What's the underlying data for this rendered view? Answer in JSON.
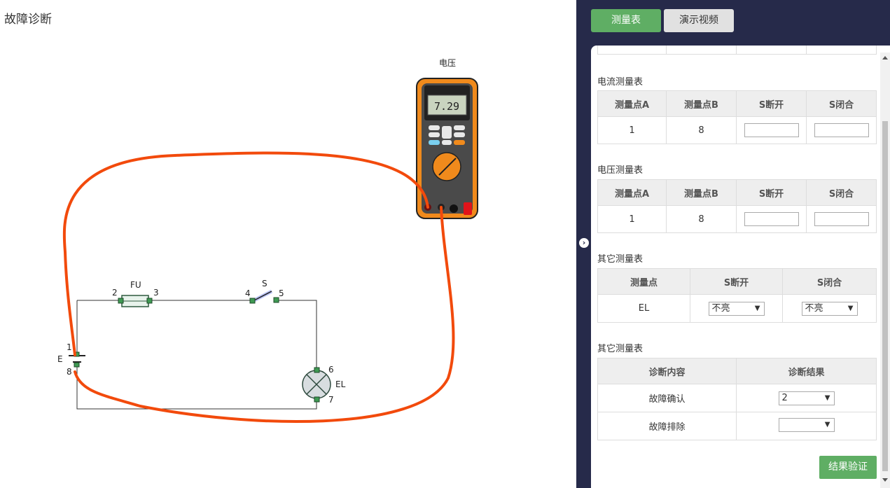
{
  "page_title": "故障诊断",
  "meter": {
    "label": "电压",
    "reading": "7.29"
  },
  "circuit": {
    "labels": {
      "fu": "FU",
      "s": "S",
      "e": "E",
      "el": "EL",
      "p1": "1",
      "p2": "2",
      "p3": "3",
      "p4": "4",
      "p5": "5",
      "p6": "6",
      "p7": "7",
      "p8": "8"
    },
    "probe_color": "#f24a0c"
  },
  "tabs": {
    "measure": "测量表",
    "video": "演示视频"
  },
  "current_table": {
    "title": "电流测量表",
    "headers": [
      "测量点A",
      "测量点B",
      "S断开",
      "S闭合"
    ],
    "row": {
      "a": "1",
      "b": "8",
      "open": "",
      "closed": ""
    }
  },
  "voltage_table": {
    "title": "电压测量表",
    "headers": [
      "测量点A",
      "测量点B",
      "S断开",
      "S闭合"
    ],
    "row": {
      "a": "1",
      "b": "8",
      "open": "",
      "closed": ""
    }
  },
  "other_table": {
    "title": "其它测量表",
    "headers": [
      "测量点",
      "S断开",
      "S闭合"
    ],
    "row": {
      "point": "EL",
      "open": "不亮",
      "closed": "不亮"
    }
  },
  "diagnosis_table": {
    "title": "其它测量表",
    "headers": [
      "诊断内容",
      "诊断结果"
    ],
    "rows": [
      {
        "content": "故障确认",
        "result": "2"
      },
      {
        "content": "故障排除",
        "result": ""
      }
    ]
  },
  "verify_button": "结果验证",
  "colors": {
    "panel_bg": "#262a4a",
    "accent_green": "#5fae64",
    "wire_orange": "#f24a0c"
  }
}
